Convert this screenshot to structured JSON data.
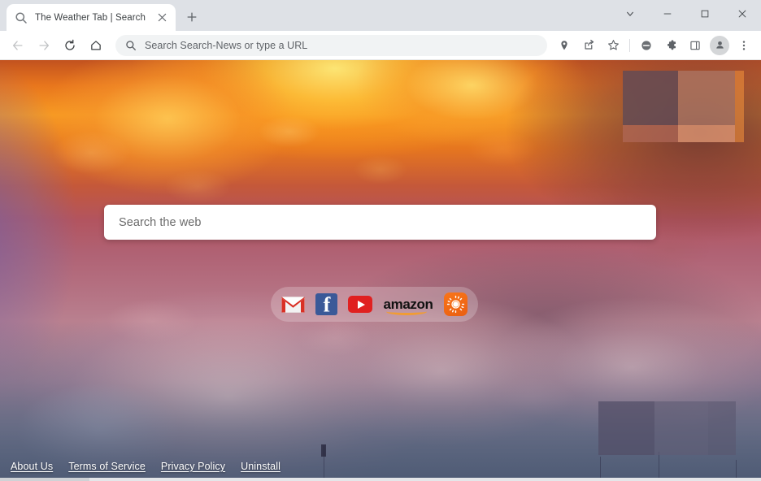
{
  "browser": {
    "tab": {
      "title": "The Weather Tab | Search",
      "favicon": "search-icon",
      "close_label": "×"
    },
    "new_tab_label": "+",
    "window_controls": {
      "tab_search": "tab-search-chevron-down-icon",
      "minimize": "minimize-icon",
      "maximize": "maximize-icon",
      "close": "close-icon"
    },
    "nav": {
      "back": "back-arrow-icon",
      "forward": "forward-arrow-icon",
      "reload": "reload-icon",
      "home": "home-icon"
    },
    "omnibox": {
      "icon": "search-icon",
      "placeholder": "Search Search-News or type a URL",
      "value": ""
    },
    "toolbar_icons": [
      {
        "name": "location-pin-icon"
      },
      {
        "name": "share-icon"
      },
      {
        "name": "bookmark-star-icon"
      },
      {
        "name": "adblock-circle-icon"
      },
      {
        "name": "extensions-puzzle-icon"
      },
      {
        "name": "side-panel-icon"
      },
      {
        "name": "profile-avatar-icon"
      },
      {
        "name": "more-vertical-menu-icon"
      }
    ]
  },
  "newtab": {
    "search": {
      "placeholder": "Search the web",
      "value": ""
    },
    "shortcuts": [
      {
        "name": "gmail",
        "label": "Gmail"
      },
      {
        "name": "facebook",
        "label": "Facebook"
      },
      {
        "name": "youtube",
        "label": "YouTube"
      },
      {
        "name": "amazon",
        "label": "amazon"
      },
      {
        "name": "weather",
        "label": "Weather"
      }
    ],
    "footer_links": [
      {
        "label": "About Us"
      },
      {
        "label": "Terms of Service"
      },
      {
        "label": "Privacy Policy"
      },
      {
        "label": "Uninstall"
      }
    ],
    "redacted_panels": [
      {
        "name": "weather-widget-top-right"
      },
      {
        "name": "weather-widget-bottom-right"
      }
    ]
  },
  "colors": {
    "accent_orange": "#f97519",
    "gmail_red": "#d93025",
    "facebook_blue": "#3b5998",
    "youtube_red": "#e02020",
    "amazon_smile": "#f19c33",
    "tab_bar": "#dee1e6",
    "toolbar": "#ffffff"
  }
}
